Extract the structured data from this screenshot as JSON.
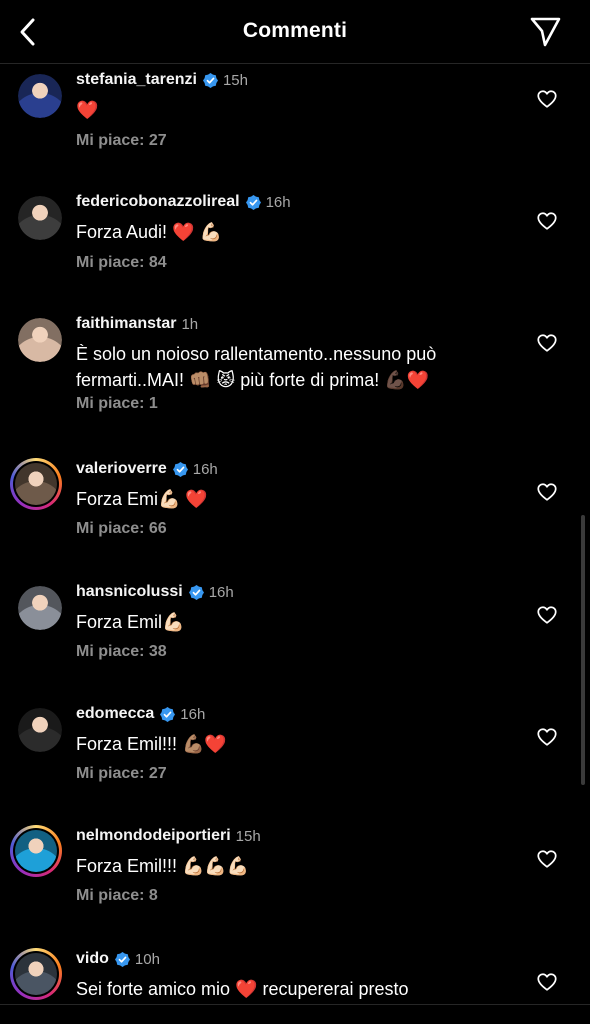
{
  "header": {
    "title": "Commenti",
    "back_icon": "chevron-left-icon",
    "send_icon": "paper-plane-icon"
  },
  "comments": [
    {
      "username": "stefania_tarenzi",
      "verified": true,
      "time": "15h",
      "text": "❤️",
      "likes": "Mi piace: 27",
      "avatar_color": "#2a3f8f",
      "story": false
    },
    {
      "username": "federicobonazzolireal",
      "verified": true,
      "time": "16h",
      "text": "Forza Audi! ❤️ 💪🏻",
      "likes": "Mi piace: 84",
      "avatar_color": "#3d3d3d",
      "story": false
    },
    {
      "username": "faithimanstar",
      "verified": false,
      "time": "1h",
      "text": "È solo un noioso rallentamento..nessuno può fermarti..MAI! 👊🏽 😾 più forte di prima! 💪🏿❤️",
      "likes": "Mi piace: 1",
      "avatar_color": "#d8b9a4",
      "story": false
    },
    {
      "username": "valerioverre",
      "verified": true,
      "time": "16h",
      "text": "Forza Emi💪🏻 ❤️",
      "likes": "Mi piace: 66",
      "avatar_color": "#6e5a4a",
      "story": true
    },
    {
      "username": "hansnicolussi",
      "verified": true,
      "time": "16h",
      "text": "Forza Emil💪🏻",
      "likes": "Mi piace: 38",
      "avatar_color": "#8a8f99",
      "story": false
    },
    {
      "username": "edomecca",
      "verified": true,
      "time": "16h",
      "text": "Forza Emil!!! 💪🏽❤️",
      "likes": "Mi piace: 27",
      "avatar_color": "#2b2b2b",
      "story": false
    },
    {
      "username": "nelmondodeiportieri",
      "verified": false,
      "time": "15h",
      "text": "Forza Emil!!! 💪🏻💪🏻💪🏻",
      "likes": "Mi piace: 8",
      "avatar_color": "#1ea0d8",
      "story": true
    },
    {
      "username": "vido",
      "verified": true,
      "time": "10h",
      "text": "Sei forte amico mio ❤️ recupererai presto",
      "likes": "",
      "avatar_color": "#4a5563",
      "story": true
    }
  ],
  "colors": {
    "background": "#000000",
    "verified_badge": "#3797f0",
    "secondary_text": "#8e8e8e"
  }
}
